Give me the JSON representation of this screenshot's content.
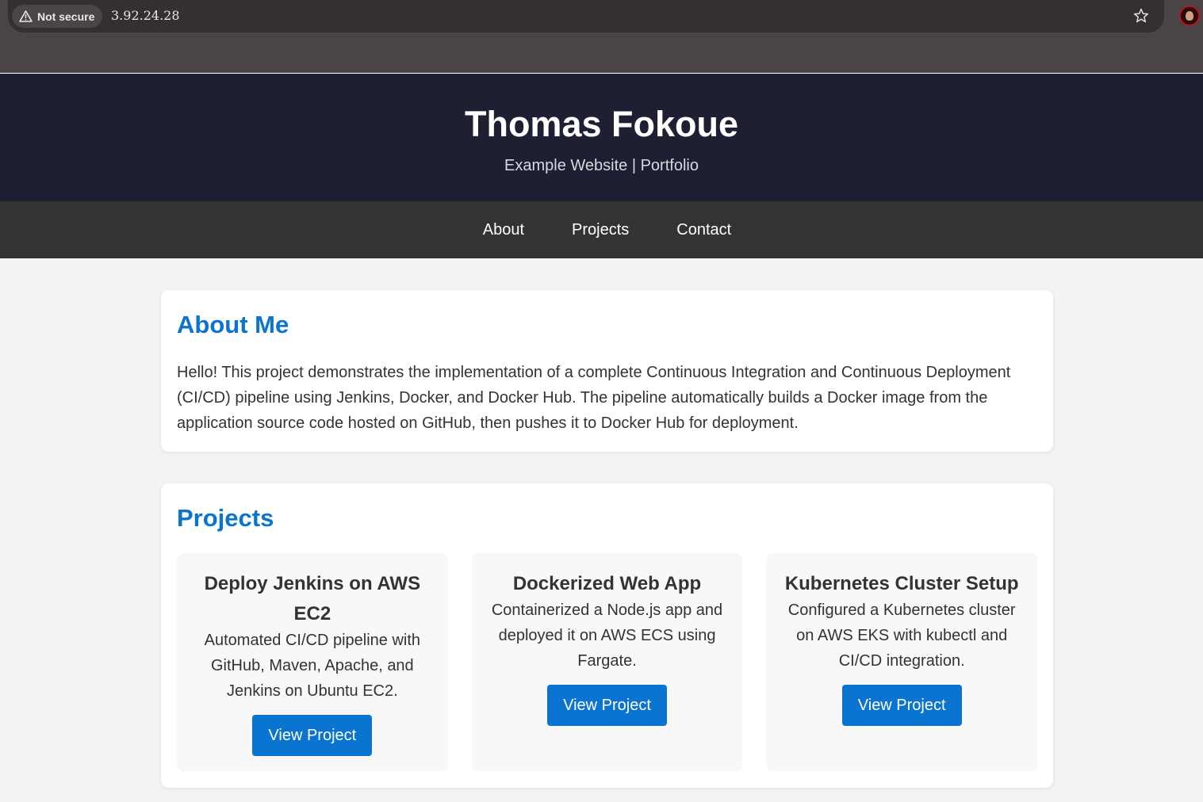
{
  "browser": {
    "security_label": "Not secure",
    "url": "3.92.24.28"
  },
  "header": {
    "title": "Thomas Fokoue",
    "subtitle": "Example Website | Portfolio"
  },
  "nav": {
    "items": [
      {
        "label": "About"
      },
      {
        "label": "Projects"
      },
      {
        "label": "Contact"
      }
    ]
  },
  "about": {
    "heading": "About Me",
    "text": "Hello! This project demonstrates the implementation of a complete Continuous Integration and Continuous Deployment (CI/CD) pipeline using Jenkins, Docker, and Docker Hub. The pipeline automatically builds a Docker image from the application source code hosted on GitHub, then pushes it to Docker Hub for deployment."
  },
  "projects": {
    "heading": "Projects",
    "items": [
      {
        "title": "Deploy Jenkins on AWS EC2",
        "description": "Automated CI/CD pipeline with GitHub, Maven, Apache, and Jenkins on Ubuntu EC2.",
        "button": "View Project"
      },
      {
        "title": "Dockerized Web App",
        "description": "Containerized a Node.js app and deployed it on AWS ECS using Fargate.",
        "button": "View Project"
      },
      {
        "title": "Kubernetes Cluster Setup",
        "description": "Configured a Kubernetes cluster on AWS EKS with kubectl and CI/CD integration.",
        "button": "View Project"
      }
    ]
  },
  "colors": {
    "header_bg": "#1f1f33",
    "nav_bg": "#333333",
    "accent": "#0a74d0",
    "page_bg": "#f2f3f5"
  },
  "icons": {
    "security": "warning-triangle-icon",
    "bookmark": "star-icon",
    "profile": "avatar"
  }
}
